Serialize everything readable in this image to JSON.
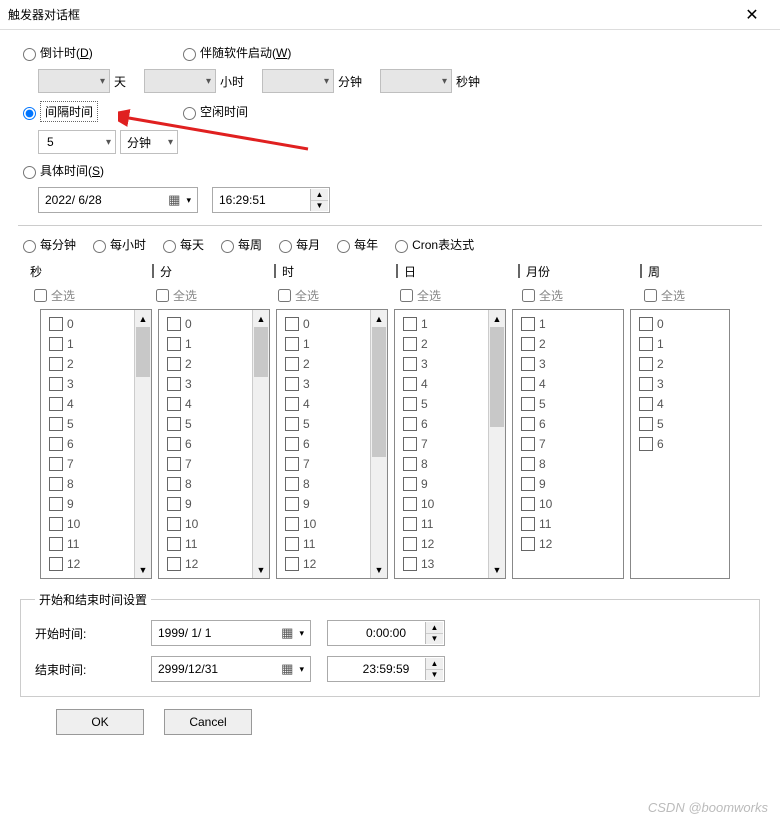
{
  "title": "触发器对话框",
  "watermark": "CSDN @boomworks",
  "top": {
    "countdown_label": "倒计时",
    "countdown_key": "D",
    "with_software_label": "伴随软件启动",
    "with_software_key": "W",
    "units": {
      "day": "天",
      "hour": "小时",
      "minute": "分钟",
      "second": "秒钟"
    }
  },
  "interval": {
    "label": "间隔时间",
    "idle_label": "空闲时间",
    "value": "5",
    "unit": "分钟"
  },
  "specific": {
    "label": "具体时间",
    "key": "S",
    "date": "2022/ 6/28",
    "time": "16:29:51"
  },
  "cron": {
    "options": {
      "per_minute": "每分钟",
      "per_hour": "每小时",
      "per_day": "每天",
      "per_week": "每周",
      "per_month": "每月",
      "per_year": "每年",
      "cron_expr": "Cron表达式"
    },
    "headers": {
      "sec": "秒",
      "min": "分",
      "hour": "时",
      "day": "日",
      "month": "月份",
      "week": "周"
    },
    "select_all": "全选",
    "lists": {
      "sec": [
        "0",
        "1",
        "2",
        "3",
        "4",
        "5",
        "6",
        "7",
        "8",
        "9",
        "10",
        "11",
        "12"
      ],
      "min": [
        "0",
        "1",
        "2",
        "3",
        "4",
        "5",
        "6",
        "7",
        "8",
        "9",
        "10",
        "11",
        "12"
      ],
      "hour": [
        "0",
        "1",
        "2",
        "3",
        "4",
        "5",
        "6",
        "7",
        "8",
        "9",
        "10",
        "11",
        "12"
      ],
      "day": [
        "1",
        "2",
        "3",
        "4",
        "5",
        "6",
        "7",
        "8",
        "9",
        "10",
        "11",
        "12",
        "13"
      ],
      "month": [
        "1",
        "2",
        "3",
        "4",
        "5",
        "6",
        "7",
        "8",
        "9",
        "10",
        "11",
        "12"
      ],
      "week": [
        "0",
        "1",
        "2",
        "3",
        "4",
        "5",
        "6"
      ]
    }
  },
  "startend": {
    "legend": "开始和结束时间设置",
    "start_label": "开始时间:",
    "start_date": "1999/ 1/ 1",
    "start_time": "0:00:00",
    "end_label": "结束时间:",
    "end_date": "2999/12/31",
    "end_time": "23:59:59"
  },
  "buttons": {
    "ok": "OK",
    "cancel": "Cancel"
  }
}
